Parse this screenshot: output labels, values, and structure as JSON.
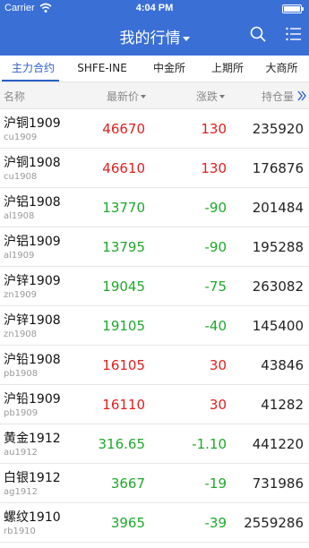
{
  "status": {
    "carrier": "Carrier",
    "time": "4:04 PM",
    "battery_level": 1.0
  },
  "header": {
    "title": "我的行情"
  },
  "tabs": [
    {
      "label": "主力合约",
      "active": true
    },
    {
      "label": "SHFE-INE",
      "active": false
    },
    {
      "label": "中金所",
      "active": false
    },
    {
      "label": "上期所",
      "active": false
    },
    {
      "label": "大商所",
      "active": false
    }
  ],
  "columns": {
    "name": "名称",
    "price": "最新价",
    "change": "涨跌",
    "open_interest": "持仓量"
  },
  "colors": {
    "up": "#e02020",
    "down": "#1fa82c",
    "header_bg": "#3a6fd6",
    "accent": "#2c5fc8"
  },
  "rows": [
    {
      "name": "沪铜1909",
      "code": "cu1909",
      "price": "46670",
      "change": "130",
      "oi": "235920",
      "dir": "up"
    },
    {
      "name": "沪铜1908",
      "code": "cu1908",
      "price": "46610",
      "change": "130",
      "oi": "176876",
      "dir": "up"
    },
    {
      "name": "沪铝1908",
      "code": "al1908",
      "price": "13770",
      "change": "-90",
      "oi": "201484",
      "dir": "down"
    },
    {
      "name": "沪铝1909",
      "code": "al1909",
      "price": "13795",
      "change": "-90",
      "oi": "195288",
      "dir": "down"
    },
    {
      "name": "沪锌1909",
      "code": "zn1909",
      "price": "19045",
      "change": "-75",
      "oi": "263082",
      "dir": "down"
    },
    {
      "name": "沪锌1908",
      "code": "zn1908",
      "price": "19105",
      "change": "-40",
      "oi": "145400",
      "dir": "down"
    },
    {
      "name": "沪铅1908",
      "code": "pb1908",
      "price": "16105",
      "change": "30",
      "oi": "43846",
      "dir": "up"
    },
    {
      "name": "沪铅1909",
      "code": "pb1909",
      "price": "16110",
      "change": "30",
      "oi": "41282",
      "dir": "up"
    },
    {
      "name": "黄金1912",
      "code": "au1912",
      "price": "316.65",
      "change": "-1.10",
      "oi": "441220",
      "dir": "down"
    },
    {
      "name": "白银1912",
      "code": "ag1912",
      "price": "3667",
      "change": "-19",
      "oi": "731986",
      "dir": "down"
    },
    {
      "name": "螺纹1910",
      "code": "rb1910",
      "price": "3965",
      "change": "-39",
      "oi": "2559286",
      "dir": "down"
    }
  ]
}
